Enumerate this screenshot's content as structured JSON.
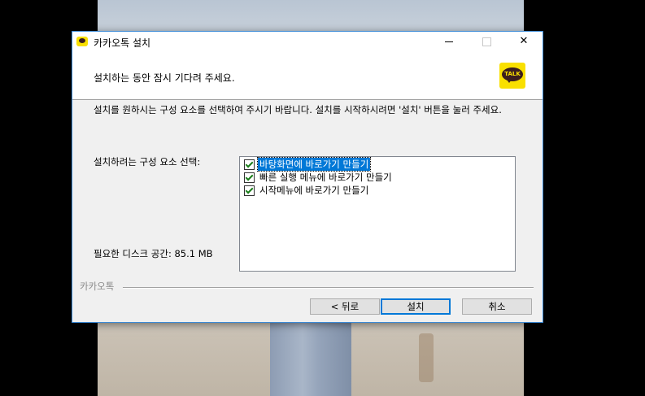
{
  "window": {
    "title": "카카오톡 설치",
    "heading": "설치하는 동안 잠시 기다려 주세요.",
    "logo_text": "TALK"
  },
  "main": {
    "instruction": "설치를 원하시는 구성 요소를 선택하여 주시기 바랍니다. 설치를 시작하시려면 '설치' 버튼을 눌러 주세요.",
    "components_label": "설치하려는 구성 요소 선택:",
    "space_required": "필요한 디스크 공간: 85.1 MB",
    "components": [
      {
        "label": "바탕화면에 바로가기 만들기",
        "checked": true,
        "selected": true
      },
      {
        "label": "빠른 실행 메뉴에 바로가기 만들기",
        "checked": true,
        "selected": false
      },
      {
        "label": "시작메뉴에 바로가기 만들기",
        "checked": true,
        "selected": false
      }
    ]
  },
  "footer": {
    "brand": "카카오톡",
    "back_label": "< 뒤로",
    "install_label": "설치",
    "cancel_label": "취소"
  },
  "colors": {
    "brand_yellow": "#f9e000",
    "selection_blue": "#0078d7",
    "window_border": "#3c8ad6"
  }
}
